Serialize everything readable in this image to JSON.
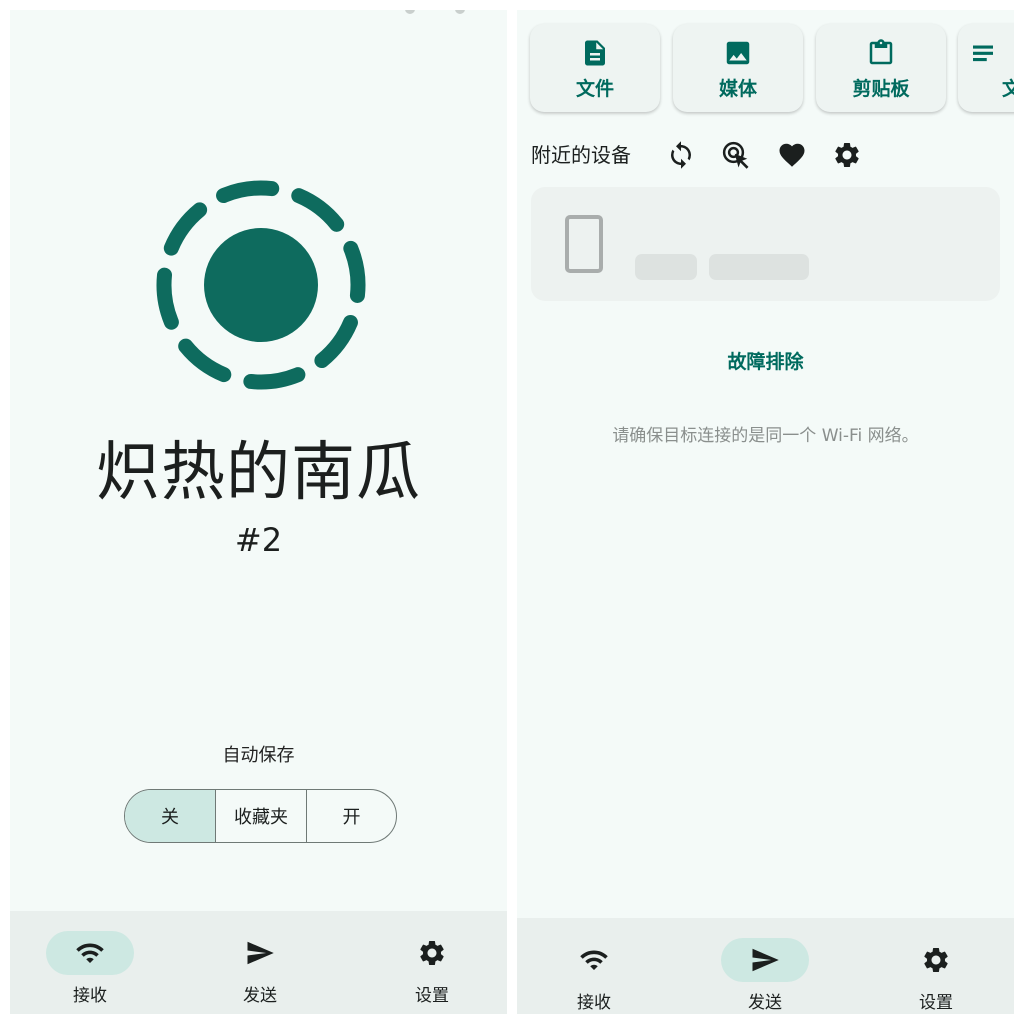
{
  "colors": {
    "accent": "#006a5e",
    "background": "#f4faf8",
    "active_indicator": "#cde8e2",
    "nav_background": "#e9efed"
  },
  "receive_screen": {
    "logo_icon": "dashed-ring-circle-logo",
    "device_name": "炽热的南瓜",
    "device_number": "#2",
    "autosave": {
      "label": "自动保存",
      "options": [
        "关",
        "收藏夹",
        "开"
      ],
      "selected": "关"
    }
  },
  "send_screen": {
    "categories": [
      {
        "label": "文件",
        "icon": "file-icon"
      },
      {
        "label": "媒体",
        "icon": "image-icon"
      },
      {
        "label": "剪贴板",
        "icon": "clipboard-icon"
      },
      {
        "label": "文",
        "icon": "text-icon"
      }
    ],
    "nearby": {
      "title": "附近的设备",
      "tools": [
        "refresh-icon",
        "tap-target-icon",
        "heart-icon",
        "gear-icon"
      ]
    },
    "troubleshoot_label": "故障排除",
    "hint": "请确保目标连接的是同一个 Wi-Fi 网络。"
  },
  "bottom_nav": {
    "items": [
      {
        "label": "接收",
        "icon": "wifi-icon"
      },
      {
        "label": "发送",
        "icon": "send-icon"
      },
      {
        "label": "设置",
        "icon": "gear-icon"
      }
    ],
    "left_active": "接收",
    "right_active": "发送"
  }
}
